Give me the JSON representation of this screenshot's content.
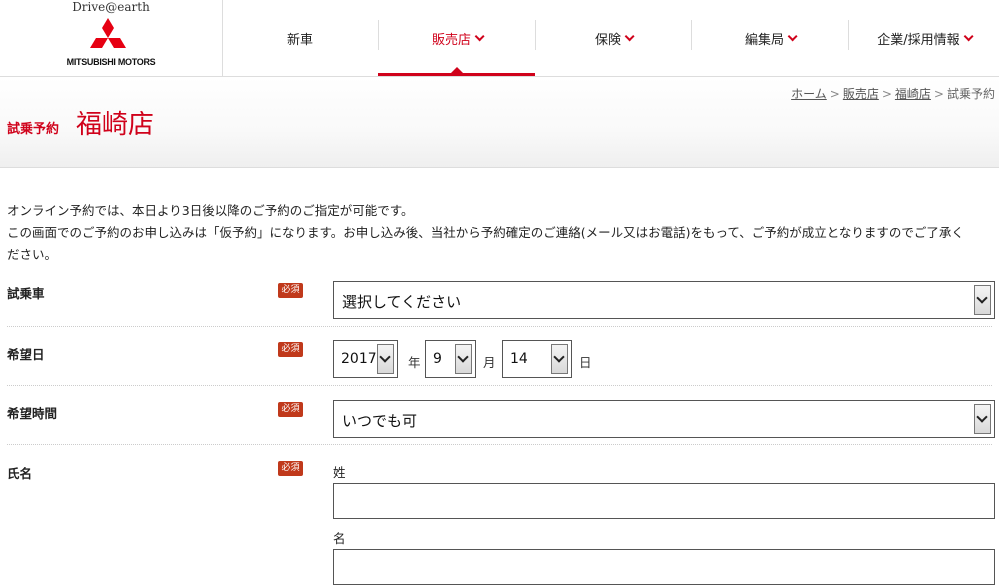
{
  "header": {
    "tagline": "Drive@earth",
    "brand": "MITSUBISHI MOTORS",
    "brand_color": "#e60012",
    "nav": [
      {
        "label": "新車",
        "chevron": false,
        "active": false
      },
      {
        "label": "販売店",
        "chevron": true,
        "active": true
      },
      {
        "label": "保険",
        "chevron": true,
        "active": false
      },
      {
        "label": "編集局",
        "chevron": true,
        "active": false
      },
      {
        "label": "企業/採用情報",
        "chevron": true,
        "active": false
      }
    ],
    "accent": "#d0021b"
  },
  "breadcrumb": {
    "items": [
      "ホーム",
      "販売店",
      "福崎店"
    ],
    "current": "試乗予約",
    "sep": ">"
  },
  "page": {
    "title_small": "試乗予約",
    "title_big": "福崎店"
  },
  "intro": {
    "line1": "オンライン予約では、本日より3日後以降のご予約のご指定が可能です。",
    "line2": "この画面でのご予約のお申し込みは「仮予約」になります。お申し込み後、当社から予約確定のご連絡(メール又はお電話)をもって、ご予約が成立となりますのでご了承く",
    "line3": "ださい。"
  },
  "form": {
    "required_badge": "必須",
    "car": {
      "label": "試乗車",
      "value": "選択してください"
    },
    "date": {
      "label": "希望日",
      "year": "2017",
      "year_unit": "年",
      "month": "9",
      "month_unit": "月",
      "day": "14",
      "day_unit": "日"
    },
    "time": {
      "label": "希望時間",
      "value": "いつでも可"
    },
    "name": {
      "label": "氏名",
      "last_label": "姓",
      "first_label": "名",
      "last_value": "",
      "first_value": ""
    }
  }
}
